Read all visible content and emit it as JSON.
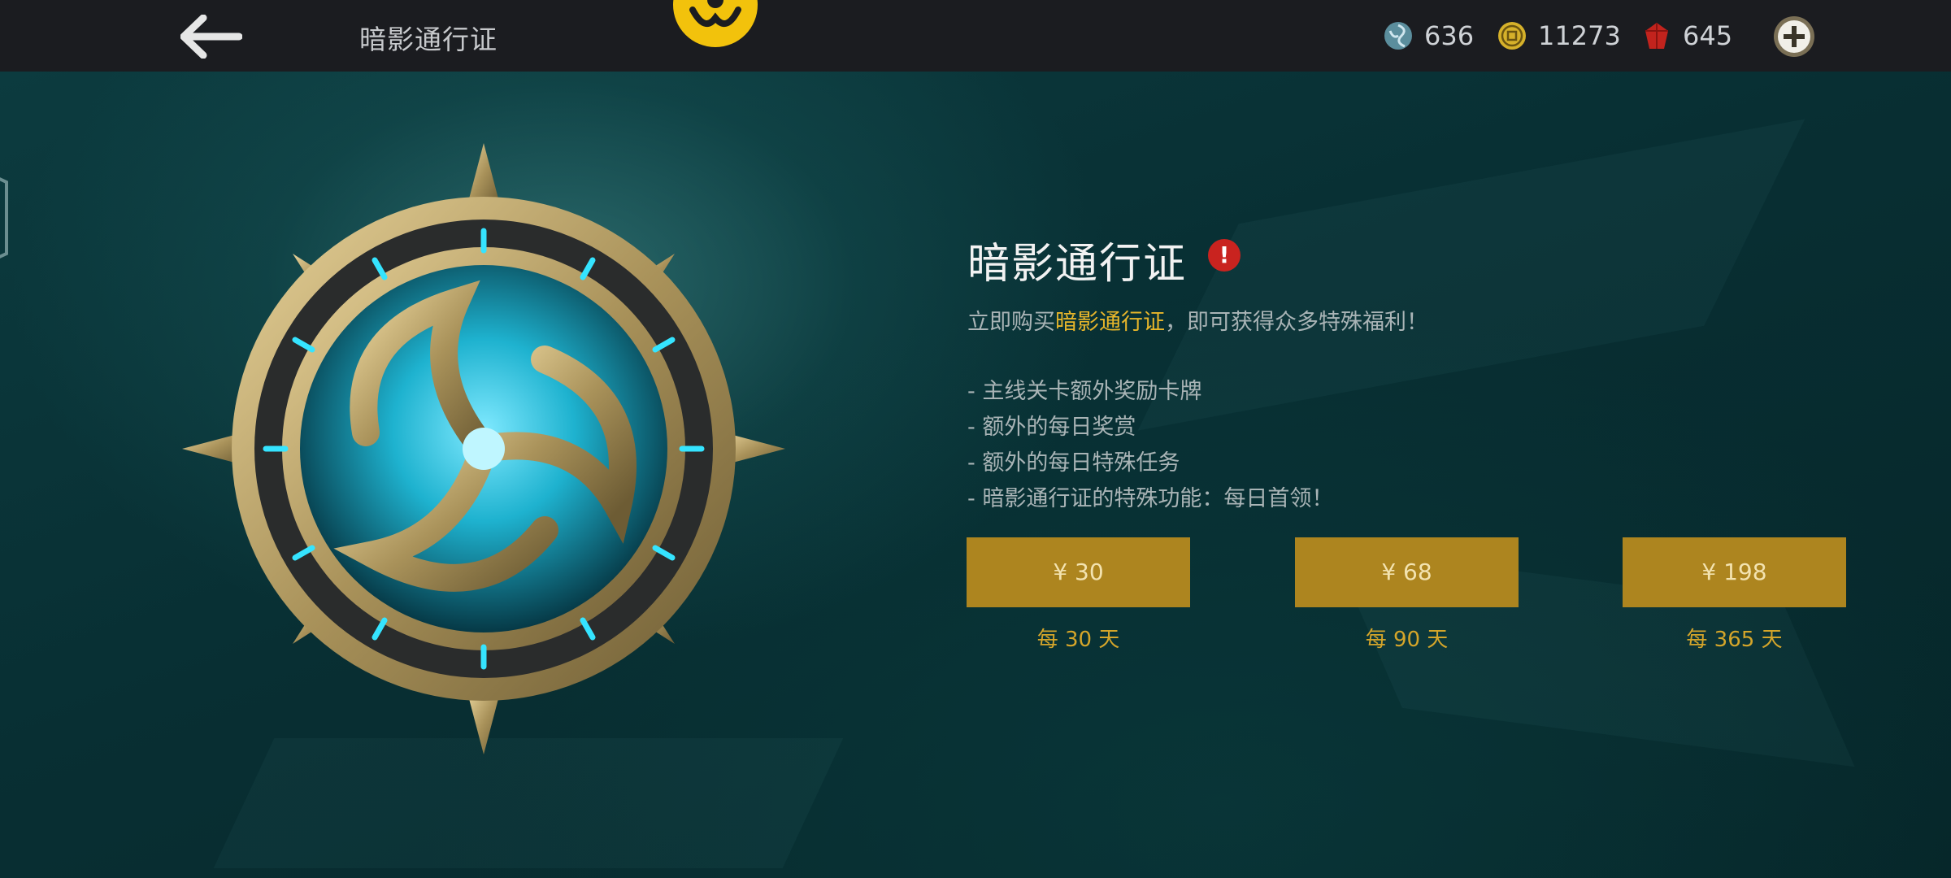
{
  "header": {
    "title": "暗影通行证",
    "back_icon": "back-arrow-icon",
    "emblem_icon": "triskelion-emblem-icon",
    "currencies": [
      {
        "icon": "swirl-token-icon",
        "value": "636"
      },
      {
        "icon": "gold-coin-icon",
        "value": "11273"
      },
      {
        "icon": "red-gem-icon",
        "value": "645"
      }
    ],
    "add_icon": "plus-circle-icon"
  },
  "pass": {
    "title": "暗影通行证",
    "alert_icon": "exclamation-icon",
    "alert_symbol": "!",
    "intro_prefix": "立即购买",
    "intro_highlight": "暗影通行证",
    "intro_suffix": "，即可获得众多特殊福利！",
    "benefits": [
      "- 主线关卡额外奖励卡牌",
      "- 额外的每日奖赏",
      "- 额外的每日特殊任务",
      "- 暗影通行证的特殊功能：每日首领！"
    ]
  },
  "offers": [
    {
      "price": "¥ 30",
      "period": "每 30 天"
    },
    {
      "price": "¥ 68",
      "period": "每 90 天"
    },
    {
      "price": "¥ 198",
      "period": "每 365 天"
    }
  ],
  "colors": {
    "accent_gold": "#ad851f",
    "highlight_yellow": "#e8b62b",
    "alert_red": "#c9231f",
    "topbar": "#1b1c20"
  }
}
